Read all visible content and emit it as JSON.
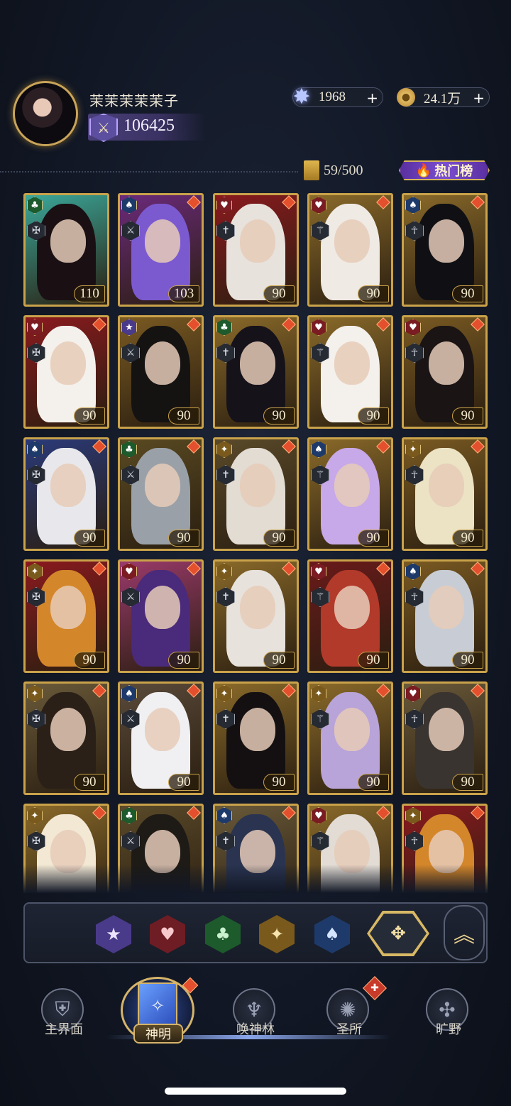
{
  "profile": {
    "name": "茉茉茉茉茉子",
    "power": "106425"
  },
  "currencies": {
    "gems": "1968",
    "coins": "24.1万",
    "add_symbol": "+"
  },
  "collection": {
    "card_count": "59/500",
    "hot_rank_label": "热门榜"
  },
  "cards": [
    {
      "level": "110",
      "suit": "club",
      "bg": "#3aa89a",
      "hair": "#1a1014"
    },
    {
      "level": "103",
      "suit": "spade",
      "bg": "#6b2a7a",
      "hair": "#7b5ad0"
    },
    {
      "level": "90",
      "suit": "heart",
      "bg": "#8a1a1e",
      "hair": "#e8e2dc"
    },
    {
      "level": "90",
      "suit": "heart",
      "bg": "#8a6a2a",
      "hair": "#efeae4"
    },
    {
      "level": "90",
      "suit": "spade",
      "bg": "#8a6a2a",
      "hair": "#101014"
    },
    {
      "level": "90",
      "suit": "heart",
      "bg": "#8a1a1e",
      "hair": "#f4f0ec"
    },
    {
      "level": "90",
      "suit": "star",
      "bg": "#7a5a22",
      "hair": "#151212"
    },
    {
      "level": "90",
      "suit": "club",
      "bg": "#8a6a2a",
      "hair": "#16121a"
    },
    {
      "level": "90",
      "suit": "heart",
      "bg": "#8a6a2a",
      "hair": "#f4f0ec"
    },
    {
      "level": "90",
      "suit": "heart",
      "bg": "#7a5a22",
      "hair": "#1a1414"
    },
    {
      "level": "90",
      "suit": "spade",
      "bg": "#2a3a7a",
      "hair": "#e8e8ec"
    },
    {
      "level": "90",
      "suit": "club",
      "bg": "#5a4a22",
      "hair": "#9aa0a8"
    },
    {
      "level": "90",
      "suit": "diamond",
      "bg": "#5a4a2a",
      "hair": "#e2dcd2"
    },
    {
      "level": "90",
      "suit": "spade",
      "bg": "#8a6a2a",
      "hair": "#c7a8e8"
    },
    {
      "level": "90",
      "suit": "diamond",
      "bg": "#7a5a22",
      "hair": "#ece2c4"
    },
    {
      "level": "90",
      "suit": "diamond",
      "bg": "#8a1a1e",
      "hair": "#d4862a"
    },
    {
      "level": "90",
      "suit": "heart",
      "bg": "#9a3a6a",
      "hair": "#4a2a7a"
    },
    {
      "level": "90",
      "suit": "diamond",
      "bg": "#8a6a2a",
      "hair": "#e8e2dc"
    },
    {
      "level": "90",
      "suit": "heart",
      "bg": "#6a1a1a",
      "hair": "#b23a2a"
    },
    {
      "level": "90",
      "suit": "spade",
      "bg": "#7a5a22",
      "hair": "#c8ccd4"
    },
    {
      "level": "90",
      "suit": "diamond",
      "bg": "#6a5a3a",
      "hair": "#2a2018"
    },
    {
      "level": "90",
      "suit": "spade",
      "bg": "#5a4a3a",
      "hair": "#f0f0f2"
    },
    {
      "level": "90",
      "suit": "diamond",
      "bg": "#8a6a2a",
      "hair": "#141012"
    },
    {
      "level": "90",
      "suit": "diamond",
      "bg": "#8a6a2a",
      "hair": "#b8a4d8"
    },
    {
      "level": "90",
      "suit": "heart",
      "bg": "#6a5a3a",
      "hair": "#3a3430"
    },
    {
      "level": "",
      "suit": "diamond",
      "bg": "#8a6a2a",
      "hair": "#f2e8d4"
    },
    {
      "level": "",
      "suit": "club",
      "bg": "#5a4a2a",
      "hair": "#1e1a16"
    },
    {
      "level": "",
      "suit": "spade",
      "bg": "#6a5a3a",
      "hair": "#2a3450"
    },
    {
      "level": "",
      "suit": "heart",
      "bg": "#8a6a2a",
      "hair": "#e2dcd4"
    },
    {
      "level": "",
      "suit": "diamond",
      "bg": "#8a1a1e",
      "hair": "#d4862a"
    }
  ],
  "suit_colors": {
    "club": "#1d5a2c",
    "heart": "#7a1c22",
    "spade": "#1e3a6a",
    "diamond": "#7a5a1c",
    "star": "#4a3a8a"
  },
  "suit_glyphs": {
    "club": "♣",
    "heart": "♥",
    "spade": "♠",
    "diamond": "✦",
    "star": "★"
  },
  "filters": {
    "star": "★",
    "heart": "♥",
    "club": "♣",
    "diamond": "✦",
    "spade": "♠",
    "all": "✥",
    "collapse": "︽"
  },
  "nav": {
    "main_world": "主界面",
    "gods": "神明",
    "summon_forest": "唤神林",
    "sanctuary": "圣所",
    "wilds": "旷野"
  }
}
